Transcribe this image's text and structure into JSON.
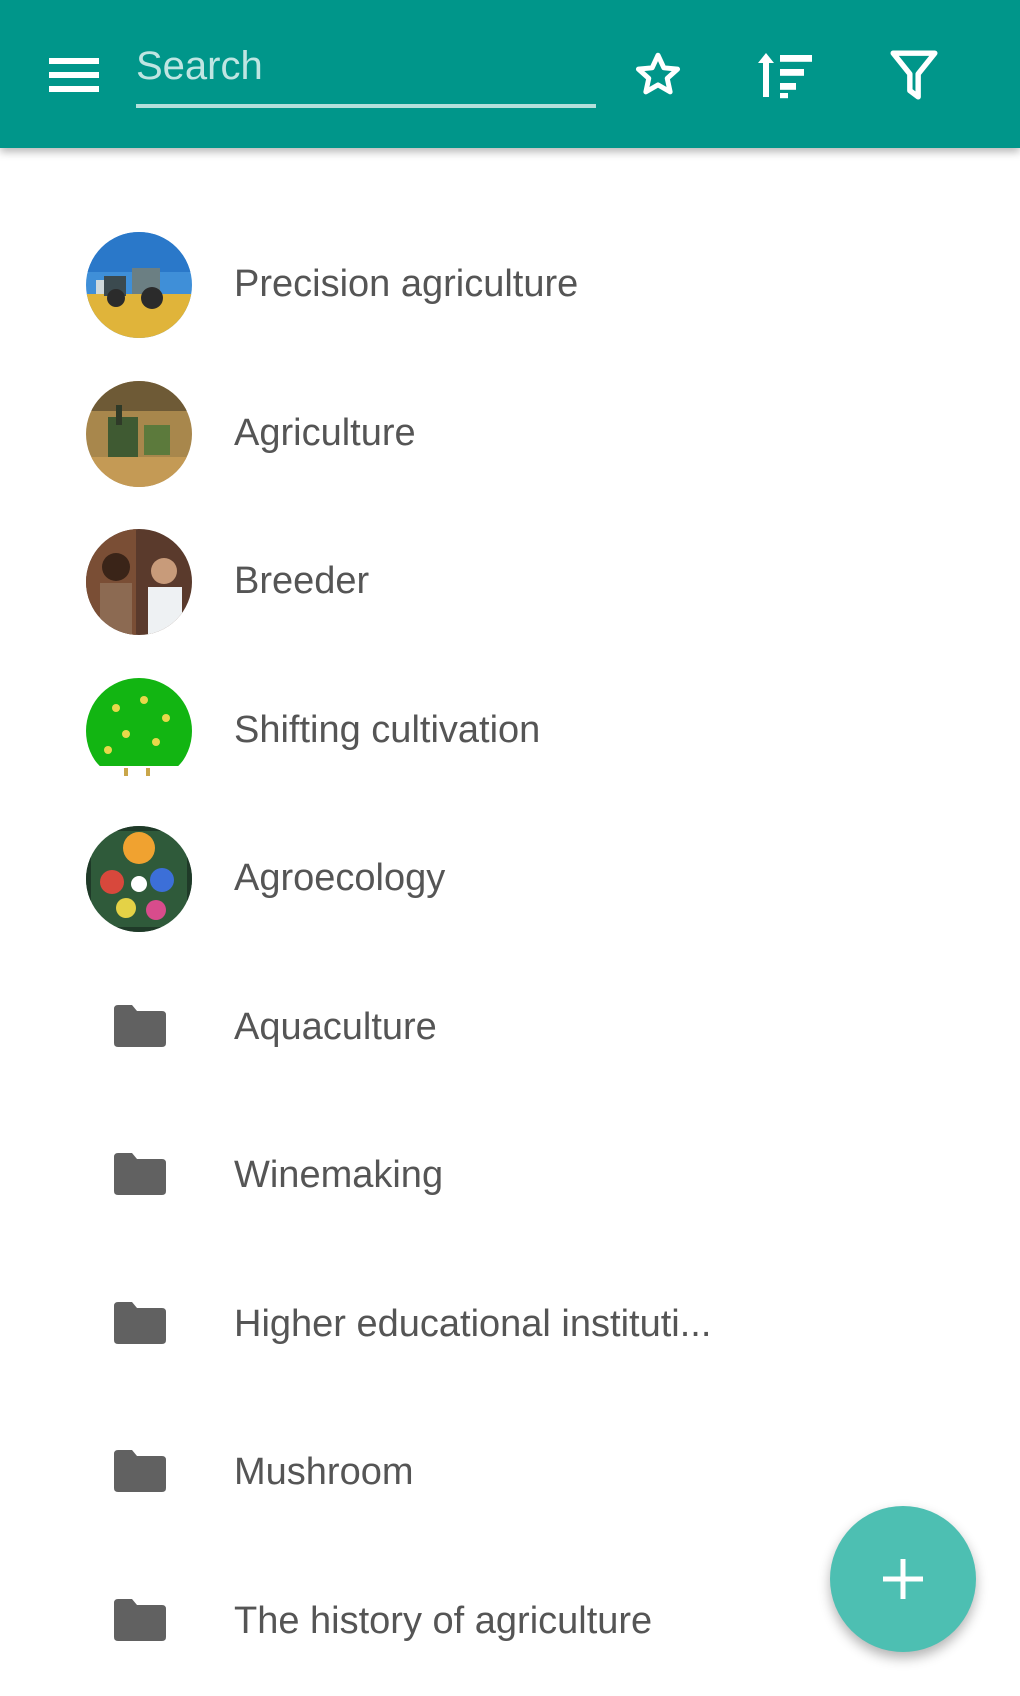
{
  "toolbar": {
    "menu_icon": "menu-icon",
    "search_placeholder": "Search",
    "search_value": "",
    "favorites_icon": "star-icon",
    "sort_icon": "sort-icon",
    "filter_icon": "filter-icon",
    "background_color": "#00968a"
  },
  "items": [
    {
      "label": "Precision agriculture",
      "type": "image"
    },
    {
      "label": "Agriculture",
      "type": "image"
    },
    {
      "label": "Breeder",
      "type": "image"
    },
    {
      "label": "Shifting cultivation",
      "type": "image"
    },
    {
      "label": "Agroecology",
      "type": "image"
    },
    {
      "label": "Aquaculture",
      "type": "folder"
    },
    {
      "label": "Winemaking",
      "type": "folder"
    },
    {
      "label": "Higher educational instituti...",
      "type": "folder"
    },
    {
      "label": "Mushroom",
      "type": "folder"
    },
    {
      "label": "The history of agriculture",
      "type": "folder"
    }
  ],
  "fab": {
    "icon": "plus-icon",
    "color": "#4dbfb2"
  }
}
